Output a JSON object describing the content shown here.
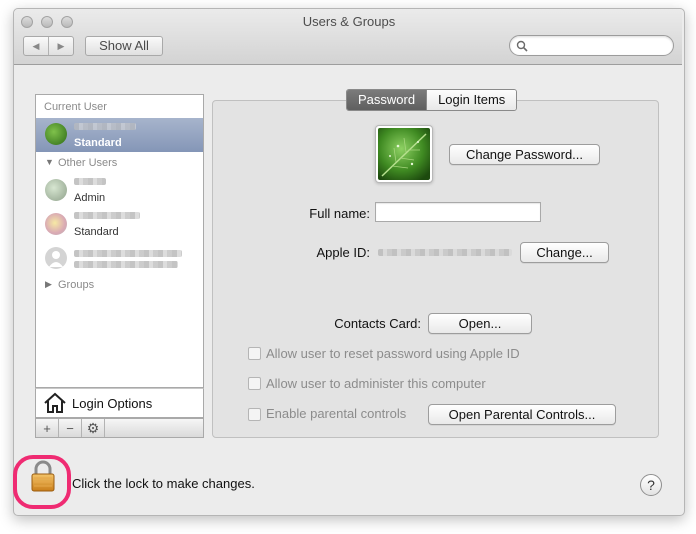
{
  "window": {
    "title": "Users & Groups"
  },
  "toolbar": {
    "back_icon": "chevron-left-icon",
    "forward_icon": "chevron-right-icon",
    "show_all_label": "Show All",
    "search_placeholder": ""
  },
  "sidebar": {
    "current_user_header": "Current User",
    "current_user": {
      "role": "Standard"
    },
    "other_users_header": "Other Users",
    "other_users": [
      {
        "role": "Admin"
      },
      {
        "role": "Standard"
      },
      {
        "role": ""
      }
    ],
    "groups_label": "Groups",
    "login_options_label": "Login Options",
    "add_symbol": "+",
    "remove_symbol": "−"
  },
  "tabs": [
    {
      "label": "Password",
      "active": true
    },
    {
      "label": "Login Items",
      "active": false
    }
  ],
  "details": {
    "change_password_label": "Change Password...",
    "full_name_label": "Full name:",
    "full_name_value": "",
    "apple_id_label": "Apple ID:",
    "change_label": "Change...",
    "contacts_card_label": "Contacts Card:",
    "open_label": "Open...",
    "checkboxes": [
      {
        "label": "Allow user to reset password using Apple ID",
        "checked": false,
        "enabled": false
      },
      {
        "label": "Allow user to administer this computer",
        "checked": false,
        "enabled": false
      },
      {
        "label": "Enable parental controls",
        "checked": false,
        "enabled": false
      }
    ],
    "open_parental_controls_label": "Open Parental Controls..."
  },
  "footer": {
    "lock_text": "Click the lock to make changes.",
    "help_label": "?"
  },
  "colors": {
    "highlight": "#ef2b72",
    "selection": "#8496b7"
  }
}
